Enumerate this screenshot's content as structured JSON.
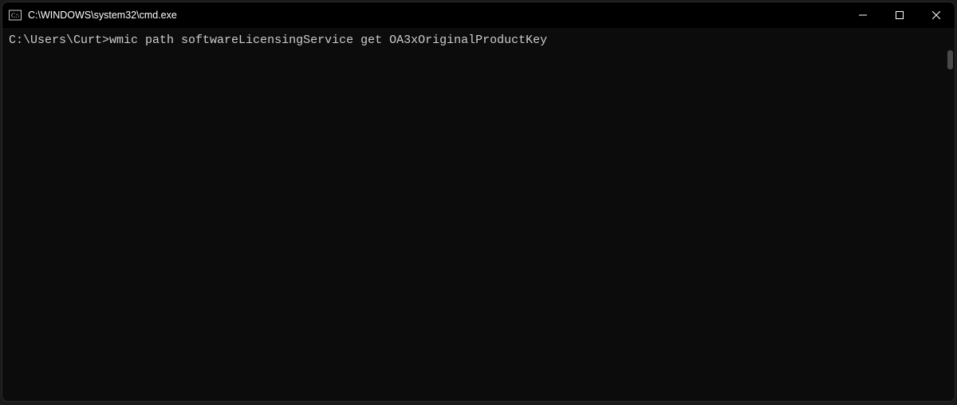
{
  "titlebar": {
    "title": "C:\\WINDOWS\\system32\\cmd.exe"
  },
  "terminal": {
    "prompt": "C:\\Users\\Curt>",
    "command": "wmic path softwareLicensingService get OA3xOriginalProductKey"
  }
}
